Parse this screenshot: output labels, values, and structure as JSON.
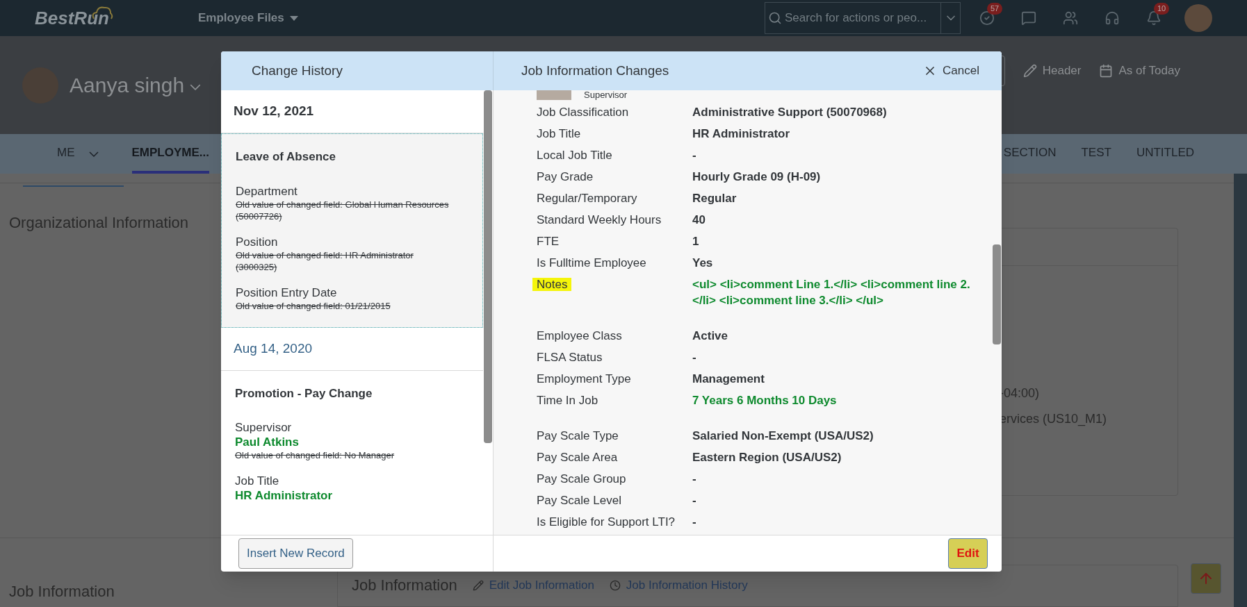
{
  "shell": {
    "logo": "BestRun",
    "app_menu": "Employee Files",
    "search": {
      "placeholder": "Search for actions or peo..."
    },
    "actions": [
      {
        "kind": "tasks",
        "badge": "57"
      },
      {
        "kind": "feedback"
      },
      {
        "kind": "people"
      },
      {
        "kind": "support"
      },
      {
        "kind": "bell",
        "badge": "10"
      }
    ]
  },
  "profile": {
    "name": "Aanya singh",
    "actions": [
      {
        "kind": "edit",
        "label": "Header"
      },
      {
        "kind": "calendar",
        "label": "As of Today"
      }
    ]
  },
  "tabs": [
    {
      "label": "ME",
      "selected": false,
      "has_menu": true
    },
    {
      "label": "EMPLOYME...",
      "selected": true,
      "has_menu": false
    },
    {
      "label": "SECTION",
      "selected": false,
      "has_menu": false
    },
    {
      "label": "TEST",
      "selected": false,
      "has_menu": false
    },
    {
      "label": "UNTITLED",
      "selected": false,
      "has_menu": false
    }
  ],
  "sections": [
    {
      "title": "Organizational Information",
      "card_lines": [
        "-04:00)",
        "ervices (US10_M1)"
      ]
    },
    {
      "title": "Job Information",
      "card_title": "Job Information",
      "card_links": [
        {
          "kind": "edit",
          "label": "Edit Job Information"
        },
        {
          "kind": "history",
          "label": "Job Information History"
        }
      ]
    }
  ],
  "dialog": {
    "history_title": "Change History",
    "details_title": "Job Information Changes",
    "cancel": "Cancel",
    "history": [
      {
        "date": "Nov 12, 2021",
        "selected": true,
        "event": "Leave of Absence",
        "changes": [
          {
            "field": "Department",
            "old": "Old value of changed field: Global Human Resources (50007726)"
          },
          {
            "field": "Position",
            "old": "Old value of changed field: HR Administrator (3000325)"
          },
          {
            "field": "Position Entry Date",
            "old": "Old value of changed field: 01/21/2015"
          }
        ]
      },
      {
        "date": "Aug 14, 2020",
        "selected": false,
        "event": "Promotion - Pay Change",
        "changes": [
          {
            "field": "Supervisor",
            "new": "Paul Atkins",
            "old": "Old value of changed field: No Manager"
          },
          {
            "field": "Job Title",
            "new": "HR Administrator"
          }
        ]
      }
    ],
    "insert_button": "Insert New Record",
    "supervisor_label": "Supervisor",
    "groups": [
      [
        {
          "label": "Job Classification",
          "value": "Administrative Support (50070968)",
          "changed": false,
          "highlighted": false
        },
        {
          "label": "Job Title",
          "value": "HR Administrator",
          "changed": false,
          "highlighted": false
        },
        {
          "label": "Local Job Title",
          "value": "-",
          "changed": false,
          "highlighted": false
        },
        {
          "label": "Pay Grade",
          "value": "Hourly Grade 09 (H-09)",
          "changed": false,
          "highlighted": false
        },
        {
          "label": "Regular/Temporary",
          "value": "Regular",
          "changed": false,
          "highlighted": false
        },
        {
          "label": "Standard Weekly Hours",
          "value": "40",
          "changed": false,
          "highlighted": false
        },
        {
          "label": "FTE",
          "value": "1",
          "changed": false,
          "highlighted": false
        },
        {
          "label": "Is Fulltime Employee",
          "value": "Yes",
          "changed": false,
          "highlighted": false
        },
        {
          "label": "Notes",
          "value": "<ul> <li>comment Line 1.</li> <li>comment line 2.</li> <li>comment line 3.</li> </ul>",
          "changed": true,
          "highlighted": true
        }
      ],
      [
        {
          "label": "Employee Class",
          "value": "Active",
          "changed": false,
          "highlighted": false
        },
        {
          "label": "FLSA Status",
          "value": "-",
          "changed": false,
          "highlighted": false
        },
        {
          "label": "Employment Type",
          "value": "Management",
          "changed": false,
          "highlighted": false
        },
        {
          "label": "Time In Job",
          "value": "7 Years 6 Months 10 Days",
          "changed": true,
          "highlighted": false
        }
      ],
      [
        {
          "label": "Pay Scale Type",
          "value": "Salaried Non-Exempt (USA/US2)",
          "changed": false,
          "highlighted": false
        },
        {
          "label": "Pay Scale Area",
          "value": "Eastern Region (USA/US2)",
          "changed": false,
          "highlighted": false
        },
        {
          "label": "Pay Scale Group",
          "value": "-",
          "changed": false,
          "highlighted": false
        },
        {
          "label": "Pay Scale Level",
          "value": "-",
          "changed": false,
          "highlighted": false
        },
        {
          "label": "Is Eligible for Support LTI?",
          "value": "-",
          "changed": false,
          "highlighted": false
        }
      ]
    ],
    "edit_button": "Edit"
  }
}
